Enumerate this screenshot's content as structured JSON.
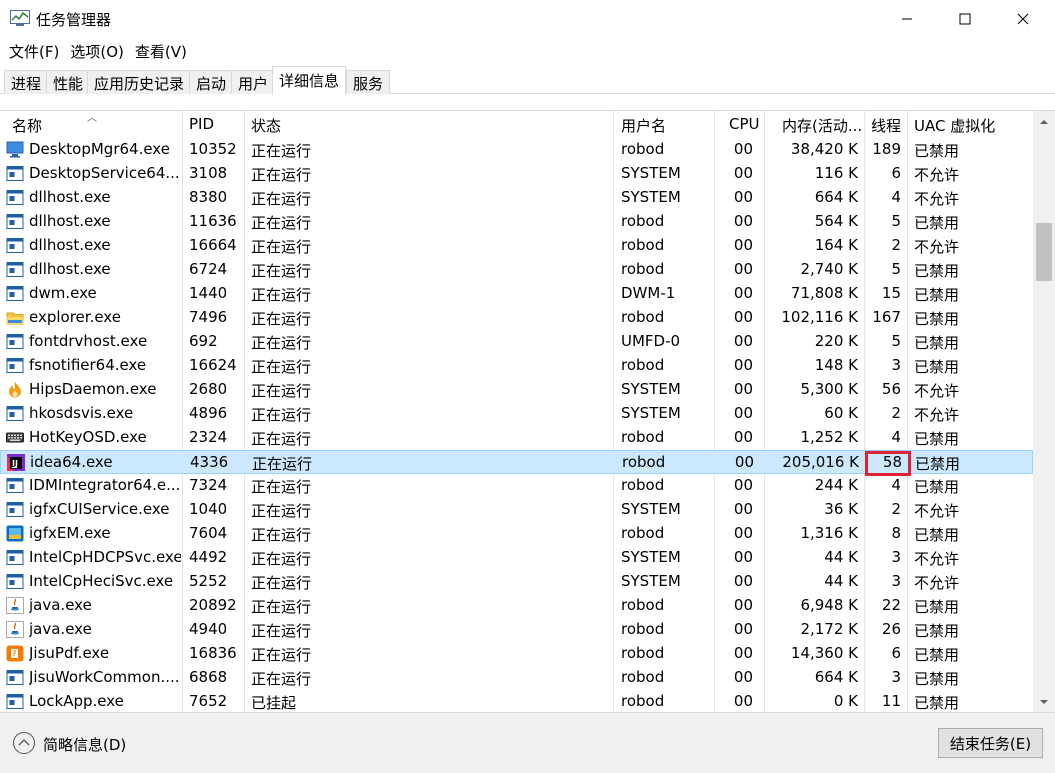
{
  "window": {
    "title": "任务管理器",
    "minimize_glyph": "—",
    "maximize_glyph": "☐",
    "close_glyph": "✕"
  },
  "menu": [
    "文件(F)",
    "选项(O)",
    "查看(V)"
  ],
  "tabs": [
    {
      "label": "进程"
    },
    {
      "label": "性能"
    },
    {
      "label": "应用历史记录"
    },
    {
      "label": "启动"
    },
    {
      "label": "用户"
    },
    {
      "label": "详细信息",
      "active": true
    },
    {
      "label": "服务"
    }
  ],
  "columns": {
    "name": "名称",
    "pid": "PID",
    "status": "状态",
    "user": "用户名",
    "cpu": "CPU",
    "mem": "内存(活动...",
    "threads": "线程",
    "uac": "UAC 虚拟化"
  },
  "rows": [
    {
      "icon": "desktop-monitor-icon",
      "name": "DesktopMgr64.exe",
      "pid": "10352",
      "status": "正在运行",
      "user": "robod",
      "cpu": "00",
      "mem": "38,420 K",
      "threads": "189",
      "uac": "已禁用"
    },
    {
      "icon": "generic-exe-icon",
      "name": "DesktopService64....",
      "pid": "3108",
      "status": "正在运行",
      "user": "SYSTEM",
      "cpu": "00",
      "mem": "116 K",
      "threads": "6",
      "uac": "不允许"
    },
    {
      "icon": "generic-exe-icon",
      "name": "dllhost.exe",
      "pid": "8380",
      "status": "正在运行",
      "user": "SYSTEM",
      "cpu": "00",
      "mem": "664 K",
      "threads": "4",
      "uac": "不允许"
    },
    {
      "icon": "generic-exe-icon",
      "name": "dllhost.exe",
      "pid": "11636",
      "status": "正在运行",
      "user": "robod",
      "cpu": "00",
      "mem": "564 K",
      "threads": "5",
      "uac": "已禁用"
    },
    {
      "icon": "generic-exe-icon",
      "name": "dllhost.exe",
      "pid": "16664",
      "status": "正在运行",
      "user": "robod",
      "cpu": "00",
      "mem": "164 K",
      "threads": "2",
      "uac": "不允许"
    },
    {
      "icon": "generic-exe-icon",
      "name": "dllhost.exe",
      "pid": "6724",
      "status": "正在运行",
      "user": "robod",
      "cpu": "00",
      "mem": "2,740 K",
      "threads": "5",
      "uac": "已禁用"
    },
    {
      "icon": "generic-exe-icon",
      "name": "dwm.exe",
      "pid": "1440",
      "status": "正在运行",
      "user": "DWM-1",
      "cpu": "00",
      "mem": "71,808 K",
      "threads": "15",
      "uac": "已禁用"
    },
    {
      "icon": "folder-icon",
      "name": "explorer.exe",
      "pid": "7496",
      "status": "正在运行",
      "user": "robod",
      "cpu": "00",
      "mem": "102,116 K",
      "threads": "167",
      "uac": "已禁用"
    },
    {
      "icon": "generic-exe-icon",
      "name": "fontdrvhost.exe",
      "pid": "692",
      "status": "正在运行",
      "user": "UMFD-0",
      "cpu": "00",
      "mem": "220 K",
      "threads": "5",
      "uac": "已禁用"
    },
    {
      "icon": "generic-exe-icon",
      "name": "fsnotifier64.exe",
      "pid": "16624",
      "status": "正在运行",
      "user": "robod",
      "cpu": "00",
      "mem": "148 K",
      "threads": "3",
      "uac": "已禁用"
    },
    {
      "icon": "shield-flame-icon",
      "name": "HipsDaemon.exe",
      "pid": "2680",
      "status": "正在运行",
      "user": "SYSTEM",
      "cpu": "00",
      "mem": "5,300 K",
      "threads": "56",
      "uac": "不允许"
    },
    {
      "icon": "generic-exe-icon",
      "name": "hkosdsvis.exe",
      "pid": "4896",
      "status": "正在运行",
      "user": "SYSTEM",
      "cpu": "00",
      "mem": "60 K",
      "threads": "2",
      "uac": "不允许"
    },
    {
      "icon": "keyboard-icon",
      "name": "HotKeyOSD.exe",
      "pid": "2324",
      "status": "正在运行",
      "user": "robod",
      "cpu": "00",
      "mem": "1,252 K",
      "threads": "4",
      "uac": "已禁用"
    },
    {
      "icon": "intellij-idea-icon",
      "name": "idea64.exe",
      "pid": "4336",
      "status": "正在运行",
      "user": "robod",
      "cpu": "00",
      "mem": "205,016 K",
      "threads": "58",
      "uac": "已禁用",
      "selected": true
    },
    {
      "icon": "generic-exe-icon",
      "name": "IDMIntegrator64.e...",
      "pid": "7324",
      "status": "正在运行",
      "user": "robod",
      "cpu": "00",
      "mem": "244 K",
      "threads": "4",
      "uac": "已禁用"
    },
    {
      "icon": "generic-exe-icon",
      "name": "igfxCUIService.exe",
      "pid": "1040",
      "status": "正在运行",
      "user": "SYSTEM",
      "cpu": "00",
      "mem": "36 K",
      "threads": "2",
      "uac": "不允许"
    },
    {
      "icon": "intel-graphics-icon",
      "name": "igfxEM.exe",
      "pid": "7604",
      "status": "正在运行",
      "user": "robod",
      "cpu": "00",
      "mem": "1,316 K",
      "threads": "8",
      "uac": "已禁用"
    },
    {
      "icon": "generic-exe-icon",
      "name": "IntelCpHDCPSvc.exe",
      "pid": "4492",
      "status": "正在运行",
      "user": "SYSTEM",
      "cpu": "00",
      "mem": "44 K",
      "threads": "3",
      "uac": "不允许"
    },
    {
      "icon": "generic-exe-icon",
      "name": "IntelCpHeciSvc.exe",
      "pid": "5252",
      "status": "正在运行",
      "user": "SYSTEM",
      "cpu": "00",
      "mem": "44 K",
      "threads": "3",
      "uac": "不允许"
    },
    {
      "icon": "java-icon",
      "name": "java.exe",
      "pid": "20892",
      "status": "正在运行",
      "user": "robod",
      "cpu": "00",
      "mem": "6,948 K",
      "threads": "22",
      "uac": "已禁用"
    },
    {
      "icon": "java-icon",
      "name": "java.exe",
      "pid": "4940",
      "status": "正在运行",
      "user": "robod",
      "cpu": "00",
      "mem": "2,172 K",
      "threads": "26",
      "uac": "已禁用"
    },
    {
      "icon": "jisupdf-icon",
      "name": "JisuPdf.exe",
      "pid": "16836",
      "status": "正在运行",
      "user": "robod",
      "cpu": "00",
      "mem": "14,360 K",
      "threads": "6",
      "uac": "已禁用"
    },
    {
      "icon": "generic-exe-icon",
      "name": "JisuWorkCommon....",
      "pid": "6868",
      "status": "正在运行",
      "user": "robod",
      "cpu": "00",
      "mem": "664 K",
      "threads": "3",
      "uac": "已禁用"
    },
    {
      "icon": "generic-exe-icon",
      "name": "LockApp.exe",
      "pid": "7652",
      "status": "已挂起",
      "user": "robod",
      "cpu": "00",
      "mem": "0 K",
      "threads": "11",
      "uac": "已禁用"
    }
  ],
  "bottom": {
    "fewer_details": "简略信息(D)",
    "end_task": "结束任务(E)"
  },
  "colors": {
    "selected_row": "#cce8ff",
    "highlight_box": "#e02235"
  }
}
